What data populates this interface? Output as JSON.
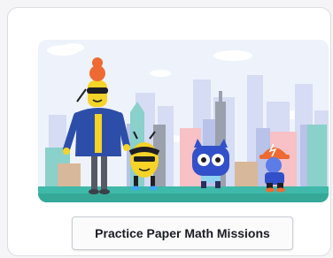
{
  "card": {
    "illustration": {
      "characters": [
        "robot-teacher",
        "bee-with-sunglasses",
        "blue-cat-robot",
        "kid-with-orange-hat"
      ]
    },
    "cta": {
      "label": "Practice Paper Math Missions"
    }
  },
  "colors": {
    "sky": "#eef2fb",
    "ground": "#3fb9a9",
    "accent_orange": "#ef6a32",
    "jacket_blue": "#2d4ea8",
    "bee_yellow": "#f5d327",
    "cat_blue": "#3150c9"
  }
}
